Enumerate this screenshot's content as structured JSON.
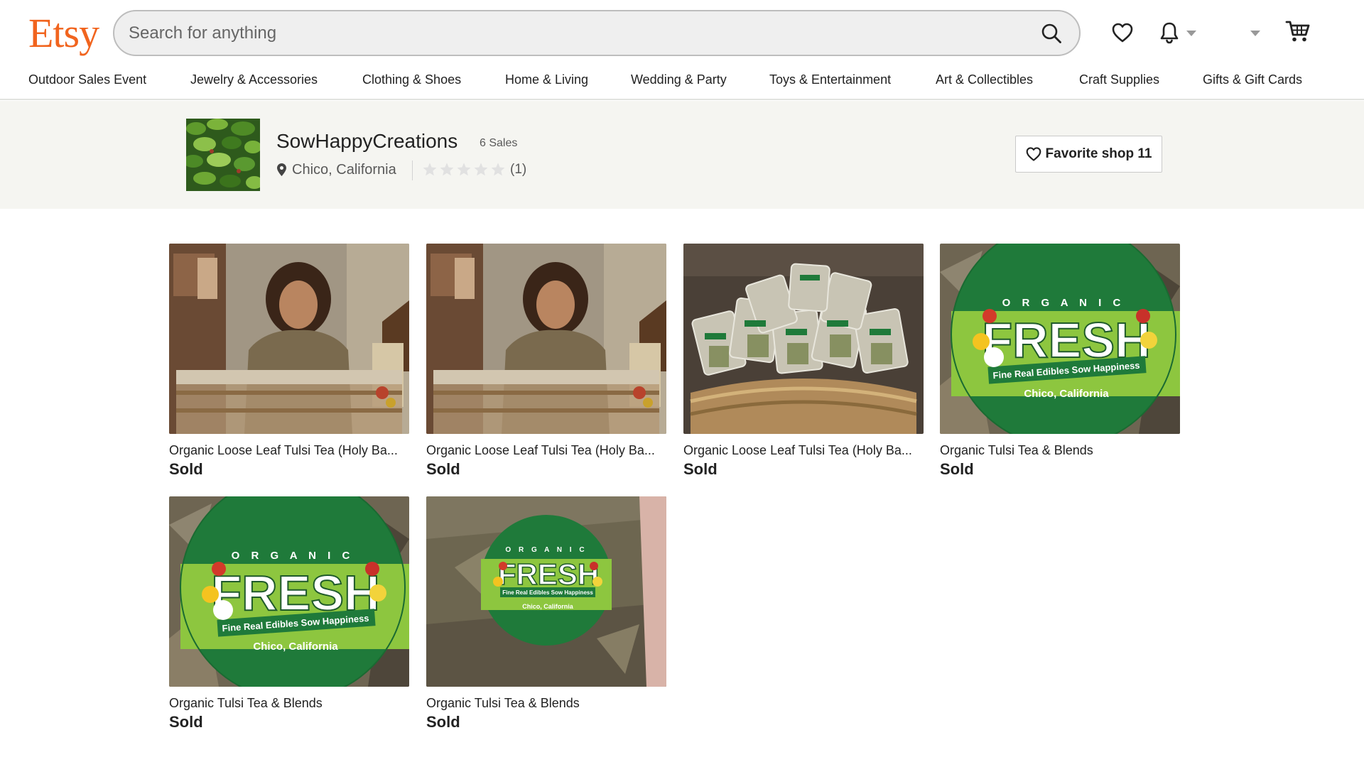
{
  "header": {
    "logo": "Etsy",
    "search_placeholder": "Search for anything",
    "icons": {
      "search": "search-icon",
      "favorites": "heart-icon",
      "notifications": "bell-icon",
      "account_menu": "chevron-down-icon",
      "cart": "cart-icon"
    }
  },
  "nav": {
    "items": [
      "Outdoor Sales Event",
      "Jewelry & Accessories",
      "Clothing & Shoes",
      "Home & Living",
      "Wedding & Party",
      "Toys & Entertainment",
      "Art & Collectibles",
      "Craft Supplies",
      "Gifts & Gift Cards"
    ]
  },
  "shop": {
    "name": "SowHappyCreations",
    "sales": "6 Sales",
    "location": "Chico, California",
    "rating_stars": 0,
    "review_count": "(1)",
    "favorite_label": "Favorite shop 11"
  },
  "listings": [
    {
      "title": "Organic Loose Leaf Tulsi Tea (Holy Ba...",
      "price": "Sold",
      "image": "woman-at-tea-stand"
    },
    {
      "title": "Organic Loose Leaf Tulsi Tea (Holy Ba...",
      "price": "Sold",
      "image": "woman-at-tea-stand"
    },
    {
      "title": "Organic Loose Leaf Tulsi Tea (Holy Ba...",
      "price": "Sold",
      "image": "tea-bags-in-basket"
    },
    {
      "title": "Organic Tulsi Tea & Blends",
      "price": "Sold",
      "image": "organic-fresh-label"
    },
    {
      "title": "Organic Tulsi Tea & Blends",
      "price": "Sold",
      "image": "organic-fresh-label"
    },
    {
      "title": "Organic Tulsi Tea & Blends",
      "price": "Sold",
      "image": "organic-fresh-label-small"
    }
  ],
  "label_art": {
    "top": "O R G A N I C",
    "word": "FRESH",
    "tagline": "Fine Real Edibles Sow Happiness",
    "city": "Chico, California"
  },
  "colors": {
    "brand": "#f1641e",
    "text": "#222222",
    "muted": "#595959",
    "banner_bg": "#f5f5f1",
    "label_green": "#1f7a3a",
    "label_lime": "#8dc63f"
  }
}
